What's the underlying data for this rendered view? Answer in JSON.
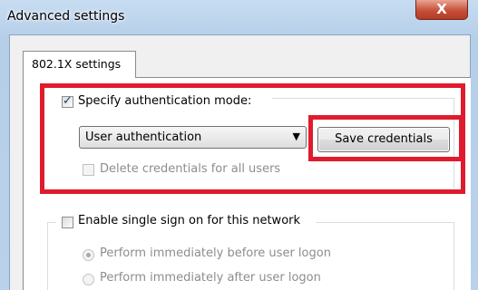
{
  "window": {
    "title": "Advanced settings",
    "close_glyph": "X"
  },
  "tabs": [
    {
      "label": "802.1X settings",
      "selected": true
    }
  ],
  "auth_group": {
    "checkbox_label": "Specify authentication mode:",
    "checked": true,
    "mode_selected": "User authentication",
    "save_button": "Save credentials",
    "delete_label": "Delete credentials for all users",
    "delete_checked": false,
    "delete_enabled": false
  },
  "sso_group": {
    "checkbox_label": "Enable single sign on for this network",
    "checked": false,
    "options": [
      {
        "label": "Perform immediately before user logon",
        "selected": true,
        "enabled": false
      },
      {
        "label": "Perform immediately after user logon",
        "selected": false,
        "enabled": false
      }
    ]
  },
  "colors": {
    "highlight": "#e01b2d",
    "titlebar": "#bcd4ea",
    "close_button": "#c7503a",
    "disabled_text": "#8d8d8d"
  },
  "icons": {
    "close": "close-icon",
    "dropdown": "chevron-down-icon"
  }
}
